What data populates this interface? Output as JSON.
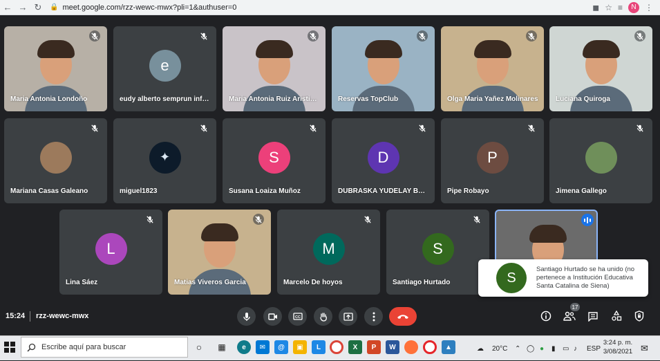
{
  "browser": {
    "url": "meet.google.com/rzz-wewc-mwx?pli=1&authuser=0",
    "profile_initial": "N"
  },
  "participants": [
    {
      "name": "Maria Antonia Londoño",
      "type": "video"
    },
    {
      "name": "eudy alberto semprun infante",
      "type": "avatar",
      "initial": "e",
      "color": "#78909c"
    },
    {
      "name": "Maria Antonia Ruiz Aristizabal",
      "type": "video"
    },
    {
      "name": "Reservas TopClub",
      "type": "video"
    },
    {
      "name": "Olga Maria Yañez Molinares",
      "type": "video"
    },
    {
      "name": "Luciana Quiroga",
      "type": "video"
    },
    {
      "name": "Mariana Casas Galeano",
      "type": "photo"
    },
    {
      "name": "miguel1823",
      "type": "photo"
    },
    {
      "name": "Susana Loaiza Muñoz",
      "type": "avatar",
      "initial": "S",
      "color": "#ec407a"
    },
    {
      "name": "DUBRASKA YUDELAY BAUTISTA",
      "type": "avatar",
      "initial": "D",
      "color": "#5e35b1"
    },
    {
      "name": "Pipe Robayo",
      "type": "avatar",
      "initial": "P",
      "color": "#6d4c41"
    },
    {
      "name": "Jimena Gallego",
      "type": "photo"
    },
    {
      "name": "Lina Sáez",
      "type": "avatar",
      "initial": "L",
      "color": "#ab47bc"
    },
    {
      "name": "Matias Viveros Garcia",
      "type": "video"
    },
    {
      "name": "Marcelo De hoyos",
      "type": "avatar",
      "initial": "M",
      "color": "#00695c"
    },
    {
      "name": "Santiago Hurtado",
      "type": "avatar",
      "initial": "S",
      "color": "#33691e"
    },
    {
      "name": "",
      "type": "video-active"
    }
  ],
  "toast": {
    "initial": "S",
    "message": "Santiago Hurtado se ha unido (no pertenece a Institución Educativa Santa Catalina de Siena)"
  },
  "meeting": {
    "time": "15:24",
    "code": "rzz-wewc-mwx",
    "participant_count": "17"
  },
  "taskbar": {
    "search_placeholder": "Escribe aquí para buscar",
    "temperature": "20°C",
    "language": "ESP",
    "time": "3:24 p. m.",
    "date": "3/08/2021"
  },
  "colors": {
    "background": "#202124",
    "tile": "#3c4043",
    "end_call": "#ea4335",
    "active_speaker": "#1a73e8"
  }
}
